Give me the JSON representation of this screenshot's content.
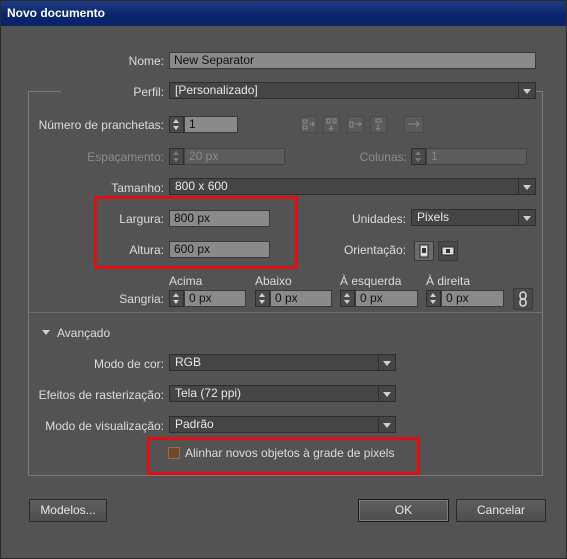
{
  "window": {
    "title": "Novo documento"
  },
  "name": {
    "label": "Nome:",
    "value": "New Separator"
  },
  "profile": {
    "label": "Perfil:",
    "value": "[Personalizado]"
  },
  "artboards": {
    "label": "Número de pranchetas:",
    "value": "1"
  },
  "spacing": {
    "label": "Espaçamento:",
    "value": "20 px"
  },
  "columns": {
    "label": "Colunas:",
    "value": "1"
  },
  "size": {
    "label": "Tamanho:",
    "value": "800 x 600"
  },
  "width": {
    "label": "Largura:",
    "value": "800 px"
  },
  "height": {
    "label": "Altura:",
    "value": "600 px"
  },
  "units": {
    "label": "Unidades:",
    "value": "Pixels"
  },
  "orientation": {
    "label": "Orientação:"
  },
  "bleed": {
    "label": "Sangria:",
    "top": {
      "label": "Acima",
      "value": "0 px"
    },
    "bottom": {
      "label": "Abaixo",
      "value": "0 px"
    },
    "left": {
      "label": "À esquerda",
      "value": "0 px"
    },
    "right": {
      "label": "À direita",
      "value": "0 px"
    }
  },
  "advanced": {
    "label": "Avançado"
  },
  "color_mode": {
    "label": "Modo de cor:",
    "value": "RGB"
  },
  "raster": {
    "label": "Efeitos de rasterização:",
    "value": "Tela (72 ppi)"
  },
  "preview": {
    "label": "Modo de visualização:",
    "value": "Padrão"
  },
  "align_pixel": {
    "label": "Alinhar novos objetos à grade de pixels",
    "checked": false
  },
  "buttons": {
    "templates": "Modelos...",
    "ok": "OK",
    "cancel": "Cancelar"
  },
  "colors": {
    "highlight": "#e01010",
    "titlebar": "#0a246a",
    "dialog_bg": "#535353"
  }
}
